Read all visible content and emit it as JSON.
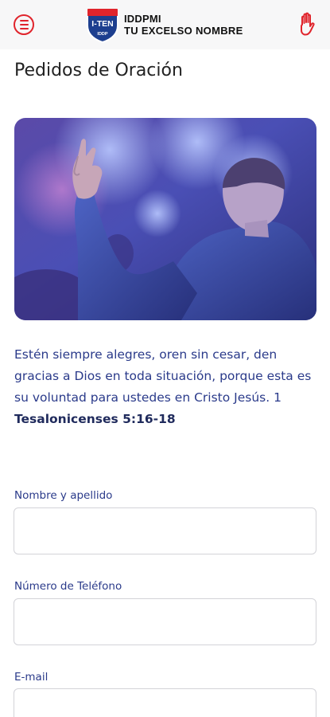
{
  "header": {
    "menu_icon": "menu-icon",
    "logo_text": "I-TEN",
    "logo_subtext": "IDDP",
    "brand_line1": "IDDPMI",
    "brand_line2": "TU EXCELSO NOMBRE",
    "hand_icon": "raised-hand-icon",
    "accent_color": "#e0242c"
  },
  "page": {
    "title": "Pedidos de Oración"
  },
  "hero": {
    "description_icon": "worship-photo"
  },
  "verse": {
    "text": "Estén siempre alegres, oren sin cesar, den gracias a Dios en toda situación, porque esta es su voluntad para ustedes en Cristo Jesús. 1",
    "reference": "Tesalonicenses 5:16-18",
    "color": "#2a3a8a"
  },
  "form": {
    "fields": [
      {
        "label": "Nombre y apellido",
        "value": ""
      },
      {
        "label": "Número de Teléfono",
        "value": ""
      },
      {
        "label": "E-mail",
        "value": ""
      }
    ]
  }
}
